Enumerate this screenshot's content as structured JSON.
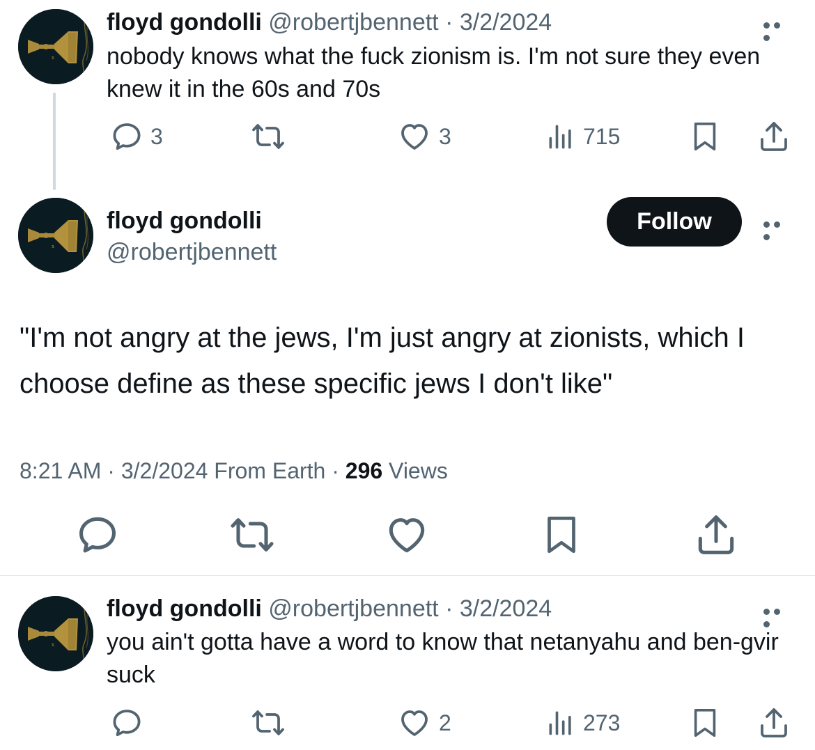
{
  "tweet1": {
    "name": "floyd gondolli",
    "handle": "@robertjbennett",
    "sep": " · ",
    "date": "3/2/2024",
    "text": "nobody knows what the fuck zionism is. I'm not sure they even knew it in the 60s and 70s",
    "replies": "3",
    "likes": "3",
    "views": "715"
  },
  "main_tweet": {
    "name": "floyd gondolli",
    "handle": "@robertjbennett",
    "follow_label": "Follow",
    "text": "\"I'm not angry at the jews, I'm just angry at zionists, which I choose define as these specific jews I don't like\"",
    "time": "8:21 AM",
    "date": "3/2/2024",
    "source": "From Earth",
    "sep": " · ",
    "views_count": "296",
    "views_label": "Views"
  },
  "tweet3": {
    "name": "floyd gondolli",
    "handle": "@robertjbennett",
    "sep": " · ",
    "date": "3/2/2024",
    "text": "you ain't gotta have a word to know that netanyahu and ben-gvir suck",
    "likes": "2",
    "views": "273"
  },
  "icons": {
    "reply": "reply-icon",
    "retweet": "retweet-icon",
    "like": "heart-icon",
    "views": "views-icon",
    "bookmark": "bookmark-icon",
    "share": "share-icon",
    "more": "more-icon"
  },
  "colors": {
    "text": "#0f1419",
    "muted": "#536471",
    "follow_bg": "#0f1419",
    "avatar_bg": "#0b1b22",
    "avatar_gold": "#a88a3a"
  }
}
